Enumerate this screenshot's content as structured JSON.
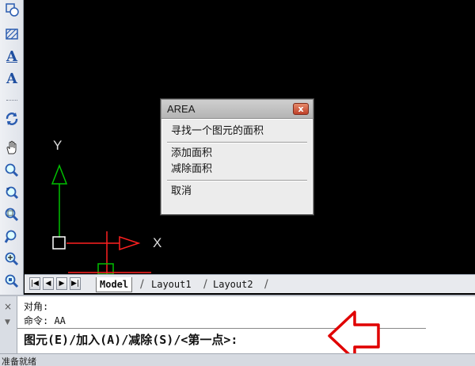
{
  "toolbar": {
    "icons": [
      "region-icon",
      "hatch-icon",
      "multiline-text-icon",
      "text-icon",
      "regen-icon",
      "pan-icon",
      "zoom-realtime-icon",
      "zoom-previous-icon",
      "zoom-window-icon",
      "zoom-dynamic-icon",
      "zoom-in-icon",
      "zoom-extents-icon"
    ],
    "glyph_mtext": "A",
    "glyph_text": "A"
  },
  "ucs": {
    "y_label": "Y",
    "x_label": "X"
  },
  "area_menu": {
    "title": "AREA",
    "close_glyph": "x",
    "items": [
      "寻找一个图元的面积",
      "添加面积",
      "减除面积",
      "取消"
    ]
  },
  "tabs": {
    "nav": [
      "|◀",
      "◀",
      "▶",
      "▶|"
    ],
    "model": "Model",
    "layout1": "Layout1",
    "layout2": "Layout2"
  },
  "command": {
    "close_glyph": "×",
    "line1": "对角:",
    "line2": "命令: AA",
    "prompt": "图元(E)/加入(A)/减除(S)/<第一点>:"
  },
  "status": {
    "text": "准备就绪"
  },
  "colors": {
    "canvas": "#000000",
    "y_axis": "#00c000",
    "x_axis": "#ff2020",
    "annotation_arrow": "#e00000"
  }
}
